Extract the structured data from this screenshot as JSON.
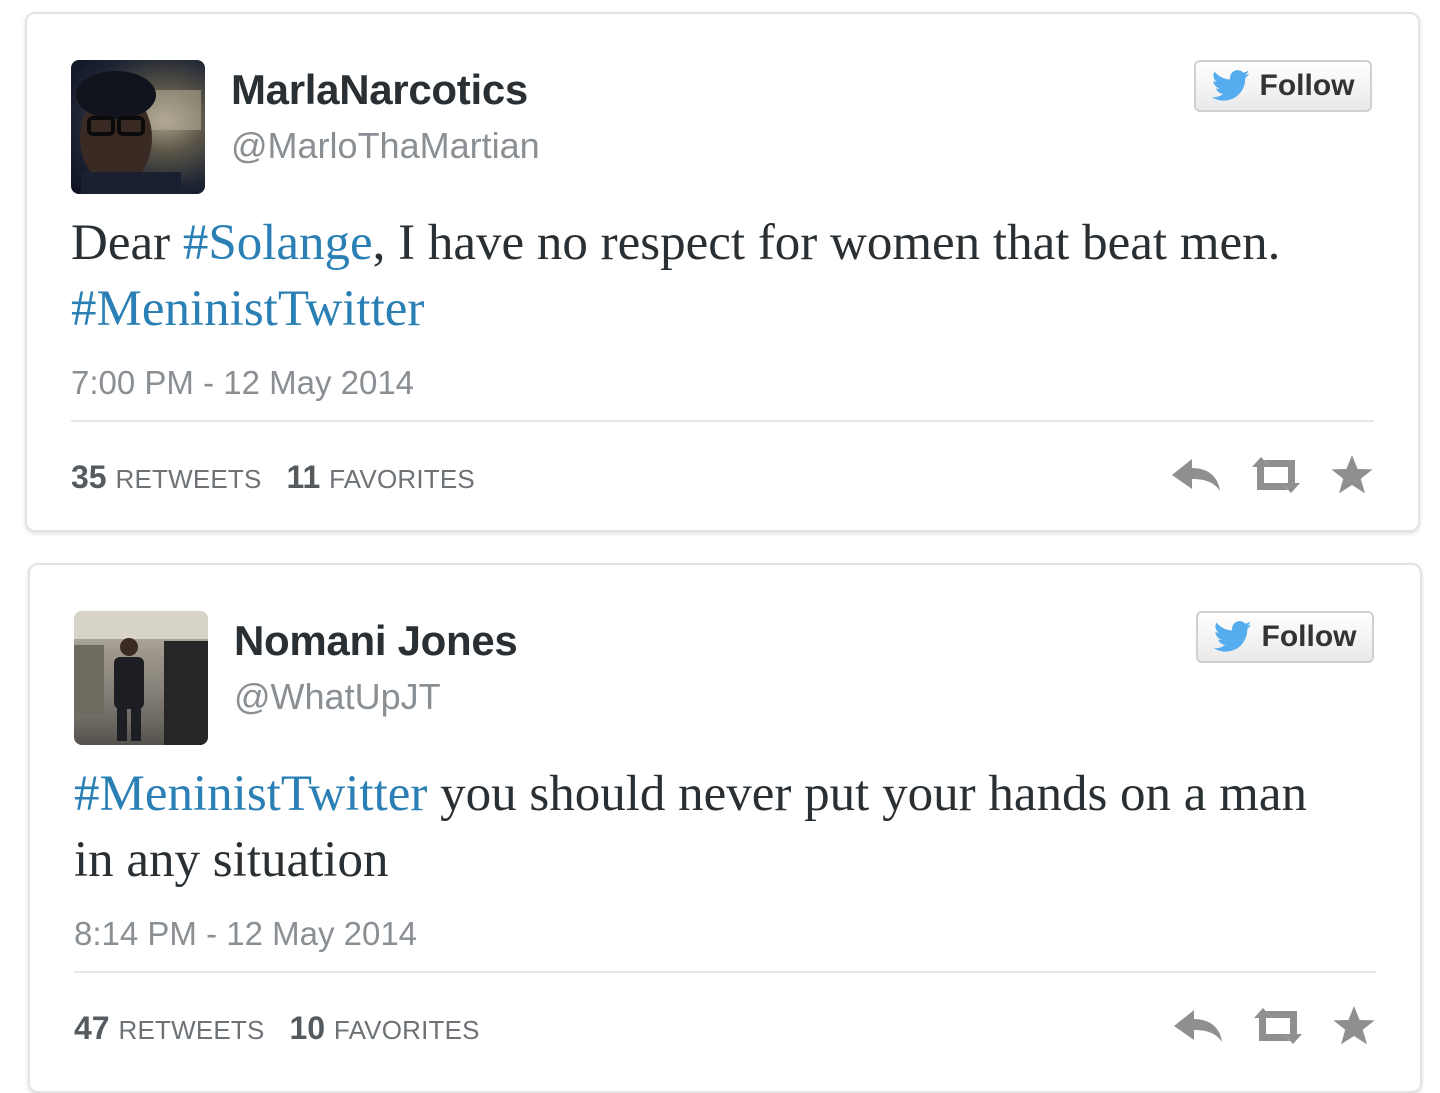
{
  "colors": {
    "hashtag": "#2a7fb5",
    "twitter_blue": "#55acee",
    "text": "#292f33",
    "muted": "#8a8f94",
    "icon_gray": "#8f8f8f"
  },
  "tweets": [
    {
      "user": {
        "name": "MarlaNarcotics",
        "handle": "@MarloThaMartian",
        "avatar_icon": "user-photo-avatar"
      },
      "follow_label": "Follow",
      "text": {
        "pre": "Dear ",
        "tag1": "#Solange",
        "mid": ", I have no respect for women that beat men. ",
        "tag2": "#MeninistTwitter"
      },
      "timestamp": "7:00 PM - 12 May 2014",
      "retweets": "35",
      "retweets_label": "RETWEETS",
      "favorites": "11",
      "favorites_label": "FAVORITES"
    },
    {
      "user": {
        "name": "Nomani Jones",
        "handle": "@WhatUpJT",
        "avatar_icon": "user-photo-avatar"
      },
      "follow_label": "Follow",
      "text": {
        "tag1": "#MeninistTwitter",
        "post": " you should never put your hands on a man in any situation"
      },
      "timestamp": "8:14 PM - 12 May 2014",
      "retweets": "47",
      "retweets_label": "RETWEETS",
      "favorites": "10",
      "favorites_label": "FAVORITES"
    }
  ],
  "icons": {
    "follow": "twitter-bird-icon",
    "reply": "reply-arrow-icon",
    "retweet": "retweet-icon",
    "favorite": "star-icon"
  }
}
